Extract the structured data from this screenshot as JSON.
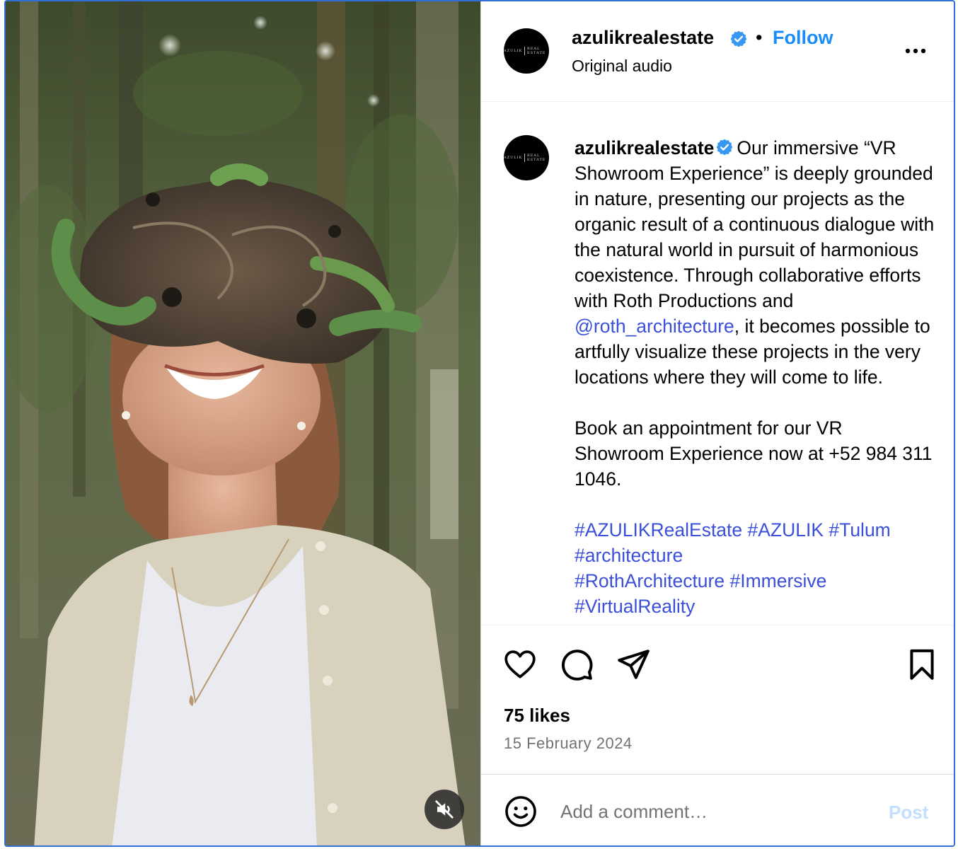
{
  "post": {
    "username": "azulikrealestate",
    "verified": true,
    "follow_label": "Follow",
    "separator": "•",
    "audio_label": "Original audio",
    "avatar_logo_text": "AZULIK",
    "avatar_logo_sub": "REAL ESTATE"
  },
  "caption": {
    "username": "azulikrealestate",
    "text_part1": "Our immersive “VR Showroom Experience” is deeply grounded in nature, presenting our projects as the organic result of a continuous dialogue with the natural world in pursuit of harmonious coexistence. Through collaborative efforts with Roth Productions and ",
    "mention": "@roth_architecture",
    "text_part2": ", it becomes possible to artfully visualize these projects in the very locations where they will come to life.\n\nBook an appointment for our VR Showroom Experience now at +52 984 311 1046.\n\n",
    "hashtags_line1": "#AZULIKRealEstate #AZULIK #Tulum",
    "hashtags_line2": "#architecture",
    "hashtags_line3": "#RothArchitecture #Immersive #VirtualReality"
  },
  "stats": {
    "likes": "75 likes",
    "date": "15 February 2024"
  },
  "comment": {
    "placeholder": "Add a comment…",
    "post_label": "Post"
  },
  "icons": {
    "like": "heart-icon",
    "comment": "comment-icon",
    "share": "share-icon",
    "save": "bookmark-icon",
    "emoji": "emoji-icon",
    "more": "more-options-icon",
    "mute": "muted-speaker-icon",
    "verified": "verified-badge-icon"
  },
  "colors": {
    "follow": "#1a8cf7",
    "link": "#3b4fd8",
    "verified": "#3897f0",
    "post_disabled": "#c2dffd"
  }
}
